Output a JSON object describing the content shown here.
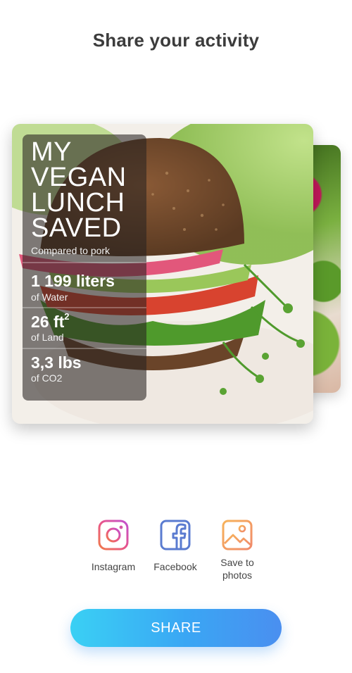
{
  "header": {
    "title": "Share your activity"
  },
  "card": {
    "hero_text": "MY VEGAN LUNCH SAVED",
    "comparison": "Compared to pork",
    "stats": [
      {
        "value": "1 199 liters",
        "unit_sup": "",
        "label": "of Water"
      },
      {
        "value": "26 ft",
        "unit_sup": "2",
        "label": "of Land"
      },
      {
        "value": "3,3 lbs",
        "unit_sup": "",
        "label": "of CO2"
      }
    ]
  },
  "share_options": [
    {
      "label": "Instagram",
      "icon": "instagram-icon",
      "color": "#e8558a"
    },
    {
      "label": "Facebook",
      "icon": "facebook-icon",
      "color": "#5a7bd0"
    },
    {
      "label": "Save to photos",
      "icon": "save-to-photos-icon",
      "color": "#f3a35a"
    }
  ],
  "share_button": {
    "label": "SHARE"
  },
  "colors": {
    "accent_start": "#3ad0f4",
    "accent_end": "#4a8ff0",
    "title": "#3c3c3c"
  }
}
